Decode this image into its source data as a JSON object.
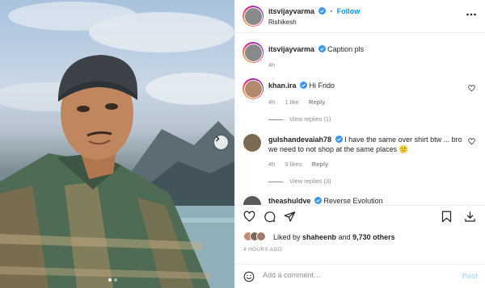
{
  "header": {
    "username": "itsvijayvarma",
    "separator": "•",
    "follow_label": "Follow",
    "location": "Rishikesh",
    "more_icon": "more-horizontal-icon"
  },
  "caption": {
    "username": "itsvijayvarma",
    "text": "Caption pls",
    "time": "4h"
  },
  "comments": [
    {
      "username": "khan.ira",
      "text": "Hi Frido",
      "time": "4h",
      "likes": "1 like",
      "reply_label": "Reply",
      "view_replies": "View replies (1)"
    },
    {
      "username": "gulshandevaiah78",
      "text": "I have the same over shirt btw ... bro we need to not shop at the same places 🙂",
      "time": "4h",
      "likes": "9 likes",
      "reply_label": "Reply",
      "view_replies": "View replies (3)"
    },
    {
      "username": "theashuldve",
      "text": "Reverse Evolution"
    }
  ],
  "likes": {
    "prefix": "Liked by",
    "user": "shaheenb",
    "connector": "and",
    "others": "9,730 others"
  },
  "timestamp": "4 HOURS AGO",
  "add_comment": {
    "placeholder": "Add a comment…",
    "post_label": "Post"
  },
  "colors": {
    "accent": "#0095f6",
    "verified": "#3897f0",
    "muted": "#8e8e8e"
  }
}
